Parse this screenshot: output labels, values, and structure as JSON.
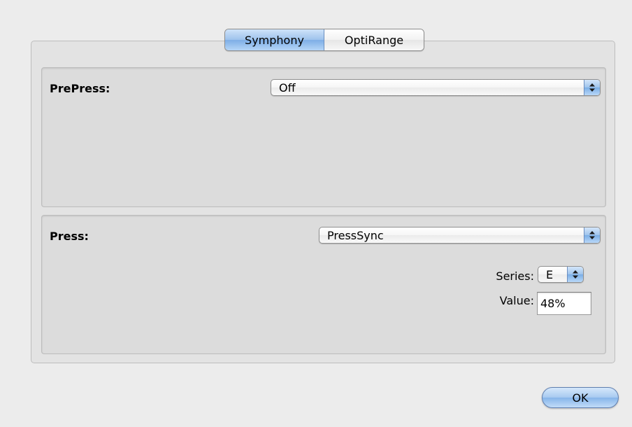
{
  "tabs": [
    {
      "label": "Symphony",
      "selected": true
    },
    {
      "label": "OptiRange",
      "selected": false
    }
  ],
  "prepress": {
    "label": "PrePress:",
    "value": "Off"
  },
  "press": {
    "label": "Press:",
    "value": "PressSync",
    "series": {
      "label": "Series:",
      "value": "E"
    },
    "value_field": {
      "label": "Value:",
      "value": "48%"
    }
  },
  "ok_label": "OK",
  "colors": {
    "window_bg": "#ececec",
    "accent_aqua": "#7daee6"
  }
}
